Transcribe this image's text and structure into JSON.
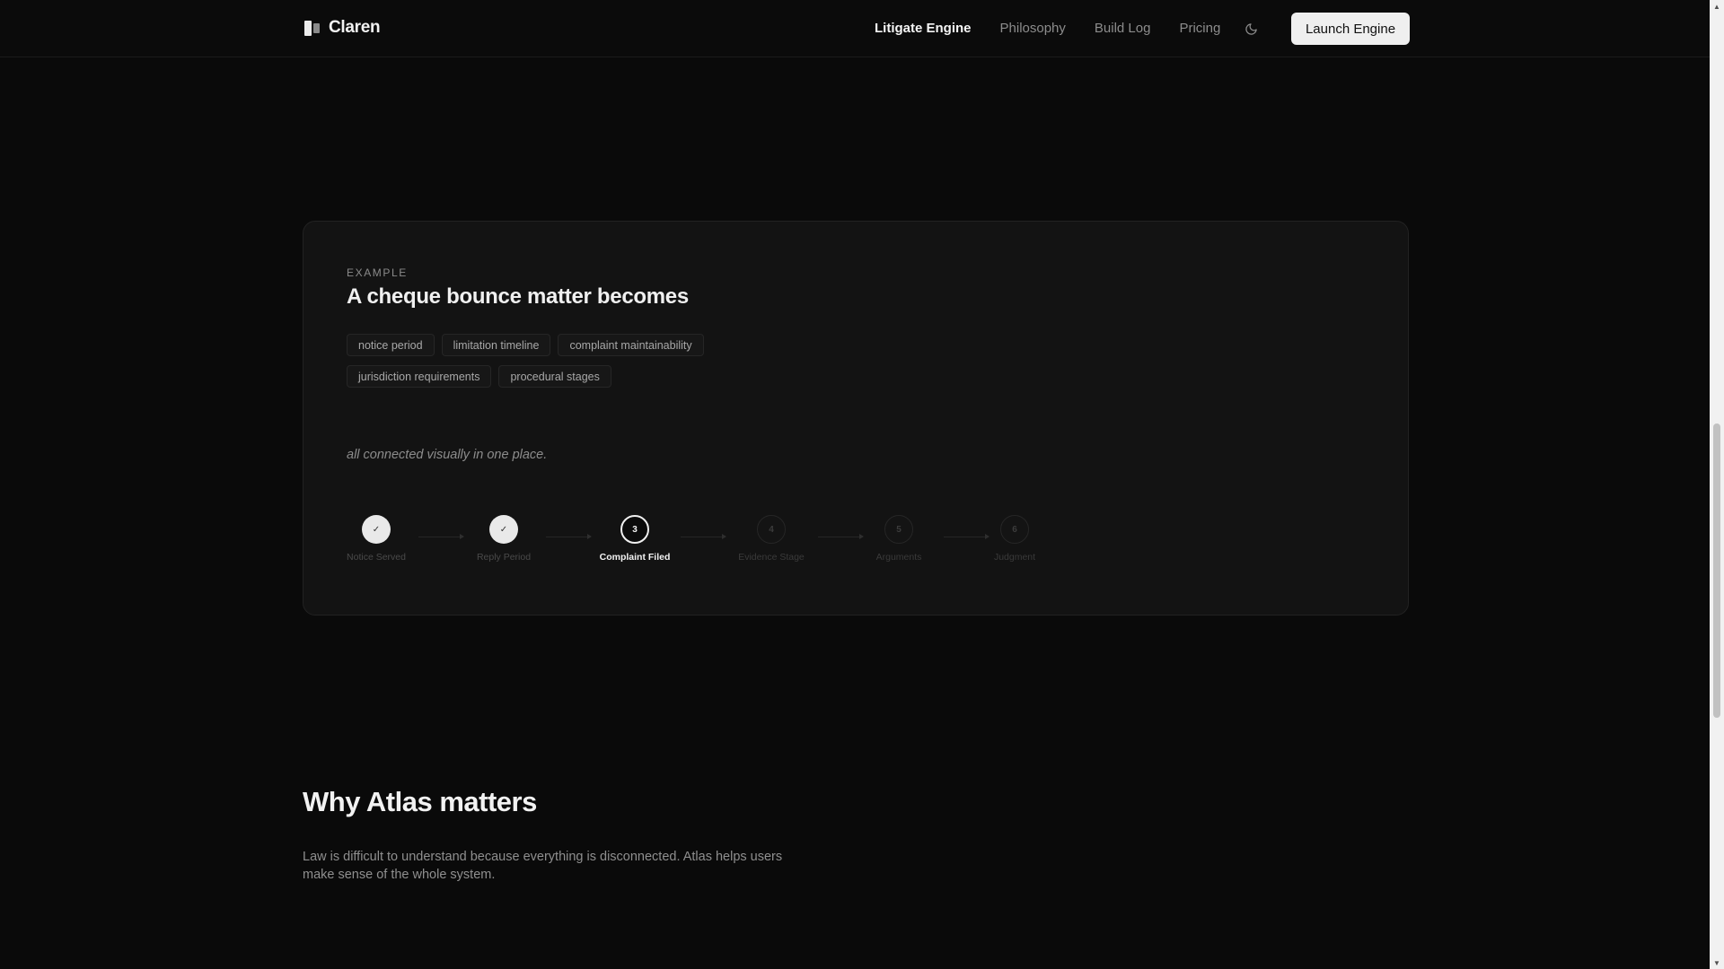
{
  "nav": {
    "brand": "Claren",
    "links": [
      {
        "label": "Litigate Engine"
      },
      {
        "label": "Philosophy"
      },
      {
        "label": "Build Log"
      },
      {
        "label": "Pricing"
      }
    ],
    "theme_icon": "moon-icon",
    "cta_label": "Launch Engine"
  },
  "example": {
    "eyebrow": "EXAMPLE",
    "title": "A cheque bounce matter becomes",
    "tags": [
      "notice period",
      "limitation timeline",
      "complaint maintainability",
      "jurisdiction requirements",
      "procedural stages"
    ],
    "tagline": "all connected visually in one place.",
    "steps": [
      {
        "marker": "✓",
        "label": "Notice Served",
        "state": "done"
      },
      {
        "marker": "✓",
        "label": "Reply Period",
        "state": "done"
      },
      {
        "marker": "3",
        "label": "Complaint Filed",
        "state": "active"
      },
      {
        "marker": "4",
        "label": "Evidence Stage",
        "state": "pending"
      },
      {
        "marker": "5",
        "label": "Arguments",
        "state": "pending"
      },
      {
        "marker": "6",
        "label": "Judgment",
        "state": "pending"
      }
    ]
  },
  "why": {
    "title": "Why Atlas matters",
    "body": "Law is difficult to understand because everything is disconnected. Atlas helps users make sense of the whole system."
  },
  "colors": {
    "background": "#0a0a0a",
    "card": "#131313",
    "accent": "#efefef"
  }
}
